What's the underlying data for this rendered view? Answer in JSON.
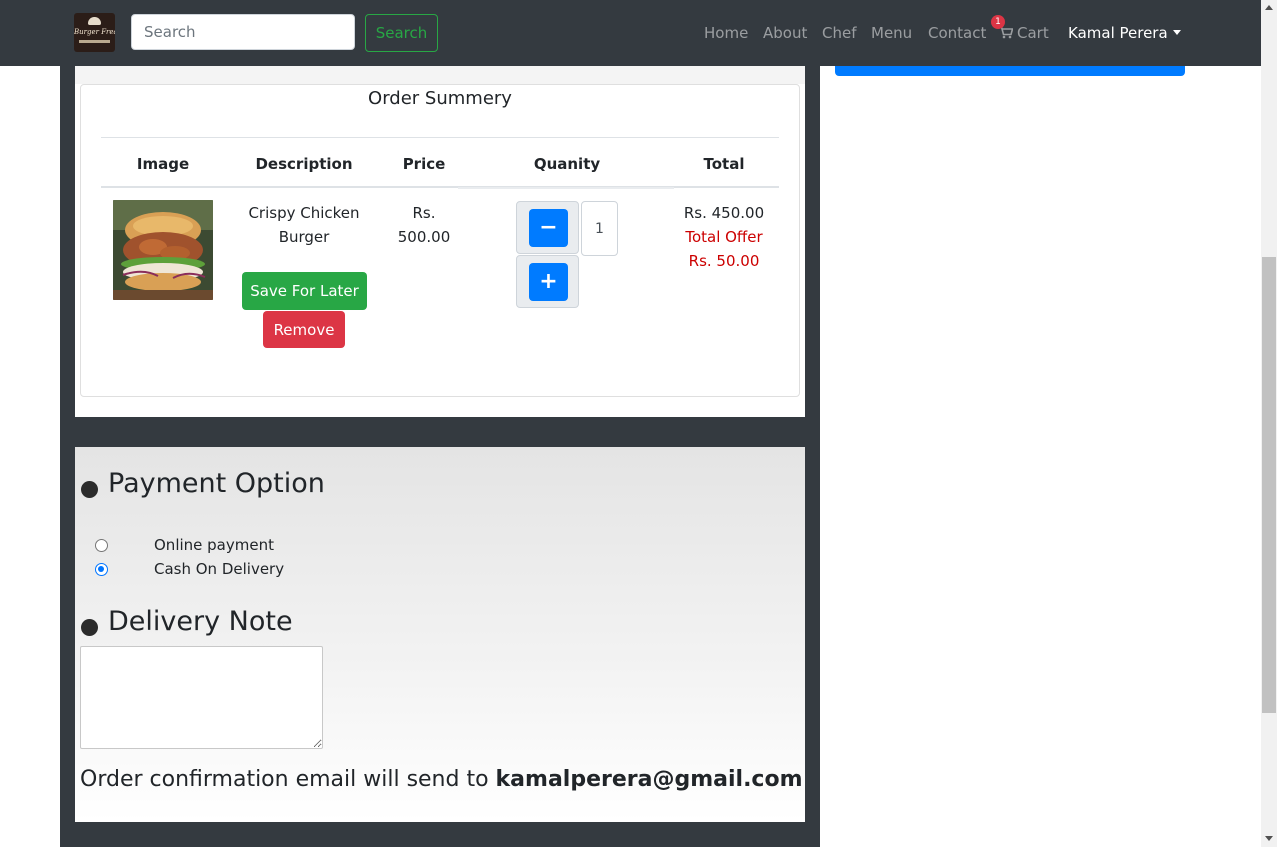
{
  "navbar": {
    "logo_text": "Burger Freaks",
    "search": {
      "placeholder": "Search",
      "value": ""
    },
    "search_button": "Search",
    "links": [
      "Home",
      "About",
      "Chef",
      "Menu",
      "Contact"
    ],
    "cart": {
      "label": "Cart",
      "count": "1"
    },
    "user": "Kamal Perera"
  },
  "order": {
    "title": "Order Summery",
    "headers": [
      "Image",
      "Description",
      "Price",
      "Quanity",
      "Total"
    ],
    "item": {
      "name_line1": "Crispy Chicken",
      "name_line2": "Burger",
      "price_line1": "Rs.",
      "price_line2": "500.00",
      "quantity": "1",
      "total": "Rs. 450.00",
      "offer_label": "Total Offer",
      "offer_value": "Rs. 50.00",
      "save_for_later": "Save For Later",
      "remove": "Remove",
      "decrement": "−",
      "increment": "+"
    }
  },
  "payment": {
    "title": "Payment Option",
    "options": [
      "Online payment",
      "Cash On Delivery"
    ],
    "selected": "Cash On Delivery"
  },
  "delivery": {
    "title": "Delivery Note",
    "note": ""
  },
  "confirmation": {
    "text": "Order confirmation email will send to",
    "email": "kamalperera@gmail.com"
  },
  "colors": {
    "navbar": "#343a40",
    "primary": "#007bff",
    "success": "#28a745",
    "danger": "#dc3545",
    "offer": "#cc0000"
  }
}
